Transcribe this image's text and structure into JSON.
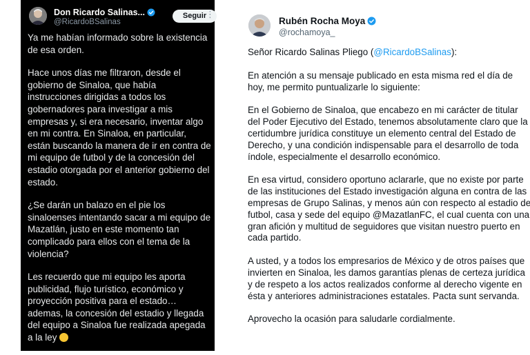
{
  "left_tweet": {
    "author_name": "Don Ricardo Salinas...",
    "author_handle": "@RicardoBSalinas",
    "follow_label": "Seguir",
    "more_icon": "⋮",
    "paragraphs": [
      "Ya me habían informado sobre la existencia de esa orden.",
      "Hace unos días me filtraron, desde el gobierno de Sinaloa, que había instrucciones dirigidas a todos los gobernadores para investigar a mis empresas y, si era necesario, inventar algo en mi contra. En Sinaloa, en particular, están buscando la manera de ir en contra de mi equipo de futbol y de la concesión del estadio otorgada por el anterior gobierno del estado.",
      "¿Se darán un balazo en el pie los sinaloenses intentando sacar a mi equipo de Mazatlán, justo en este momento tan complicado para ellos con el tema de la violencia?",
      "Les recuerdo que mi equipo les aporta publicidad, flujo turístico, económico y proyección positiva para el estado… ademas, la concesión del estadio y llegada del equipo a Sinaloa fue realizada apegada a la ley"
    ],
    "emoji_icon": "grinning-sweat-emoji"
  },
  "right_tweet": {
    "author_name": "Rubén Rocha Moya",
    "author_handle": "@rochamoya_",
    "greeting_prefix": "Señor Ricardo Salinas Pliego (",
    "greeting_mention": "@RicardoBSalinas",
    "greeting_suffix": "):",
    "paragraphs": [
      "En atención a su mensaje publicado en esta misma red el día de hoy, me permito puntualizarle lo siguiente:",
      "En el Gobierno de Sinaloa, que encabezo en mi carácter de titular del Poder Ejecutivo del Estado, tenemos absolutamente claro que la certidumbre jurídica constituye un elemento central del Estado de Derecho, y una condición indispensable para el desarrollo de toda índole, especialmente el desarrollo económico.",
      "En esa virtud, considero oportuno aclararle, que no existe por parte de las instituciones del Estado investigación alguna en contra de las empresas de Grupo Salinas, y menos aún con respecto al estadio de futbol, casa y sede del equipo @MazatlanFC, el cual cuenta con una gran afición y multitud de seguidores que visitan nuestro puerto en cada partido.",
      "A usted, y a todos los empresarios de México y de otros países que invierten en Sinaloa, les damos garantías plenas de certeza jurídica y de respeto a los actos realizados conforme al derecho vigente en ésta y anteriores administraciones estatales. Pacta sunt servanda.",
      "Aprovecho la ocasión para saludarle cordialmente."
    ]
  },
  "colors": {
    "verified_blue": "#1d9bf0",
    "dark_bg": "#000000",
    "mention_blue": "#1d9bf0"
  }
}
